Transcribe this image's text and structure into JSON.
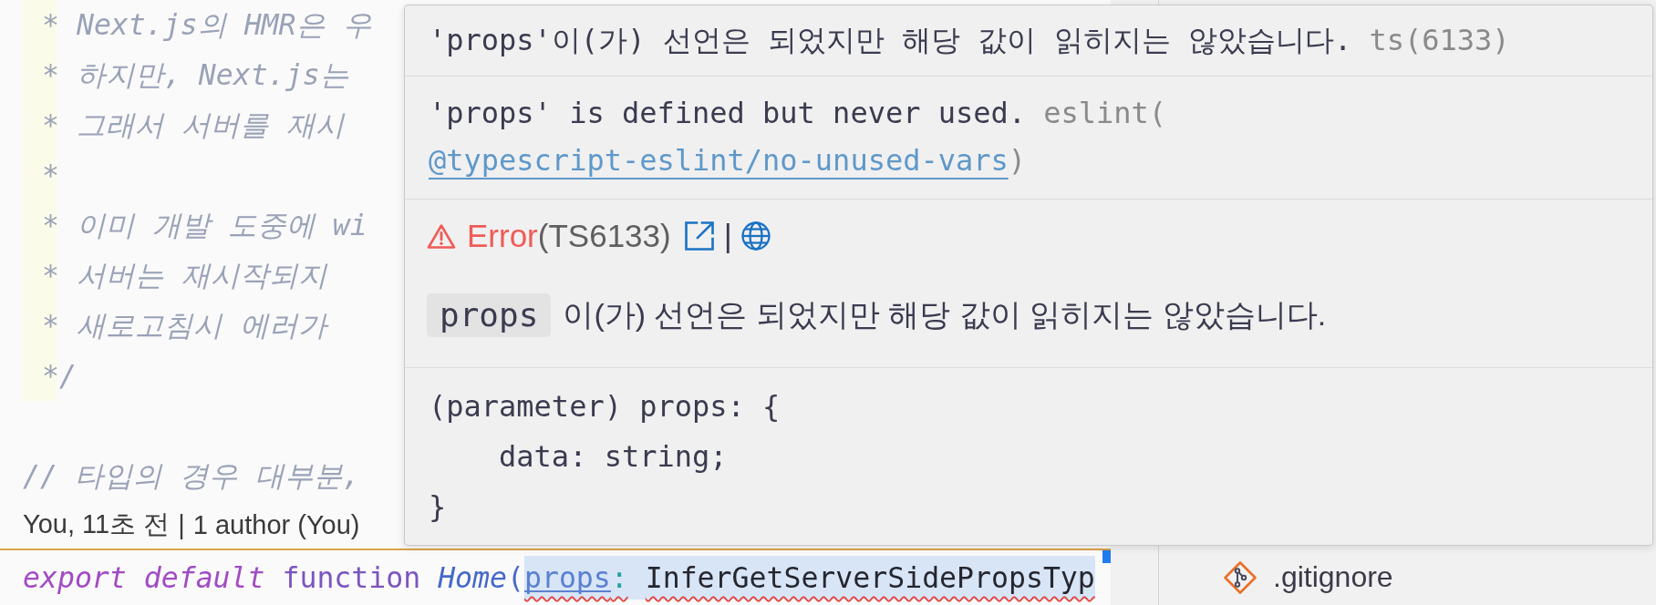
{
  "editor": {
    "comment_block": [
      "* Next.js의 HMR은 우",
      "* 하지만, Next.js는",
      "* 그래서 서버를 재시",
      "*",
      "* 이미 개발 도중에 wi",
      "* 서버는 재시작되지",
      "* 새로고침시 에러가",
      "*/"
    ],
    "lines": [
      {
        "kind": "comment",
        "text": "// 타입의 경우 대부분,"
      },
      {
        "kind": "codelens",
        "items": [
          "You, 11초 전",
          "1 author (You)"
        ],
        "separator": "|"
      },
      {
        "kind": "code",
        "current": true,
        "tokens": [
          {
            "text": "export",
            "kind": "modifier",
            "selected": false,
            "flagged": false
          },
          {
            "text": "default",
            "kind": "modifier",
            "selected": false,
            "flagged": false
          },
          {
            "text": "function",
            "kind": "keyword",
            "selected": false,
            "flagged": false
          },
          {
            "text": "Home",
            "kind": "function",
            "selected": false,
            "flagged": false
          },
          {
            "text": "(",
            "kind": "paren",
            "selected": false,
            "flagged": false
          },
          {
            "text": "props",
            "kind": "parameter",
            "selected": true,
            "flagged": true
          },
          {
            "text": ":",
            "kind": "colon",
            "selected": true,
            "flagged": true
          },
          {
            "text": "InferGetServerSidePropsTyp",
            "kind": "type",
            "selected": true,
            "flagged": true
          }
        ]
      }
    ]
  },
  "hover": {
    "sections": [
      {
        "kind": "message",
        "text": "'props'이(가) 선언은 되었지만 해당 값이 읽히지는 않았습니다.",
        "source": "ts(6133)"
      },
      {
        "kind": "lint",
        "text": "'props' is defined but never used.",
        "source": "eslint(",
        "link": "@typescript-eslint/no-unused-vars",
        "source_end": ")"
      },
      {
        "kind": "doc",
        "severity": {
          "kind": "error",
          "label": "Error"
        },
        "code": "(TS6133)",
        "separator": "|",
        "code_span": "props",
        "text": "이(가) 선언은 되었지만 해당 값이 읽히지는 않았습니다."
      },
      {
        "kind": "signature",
        "lines": [
          {
            "text": "(parameter) props: {",
            "children": [
              {
                "text": "data: string;"
              }
            ]
          },
          {
            "text": "}"
          }
        ]
      }
    ]
  },
  "explorer": {
    "items": [
      {
        "label": ".gitignore"
      }
    ]
  }
}
